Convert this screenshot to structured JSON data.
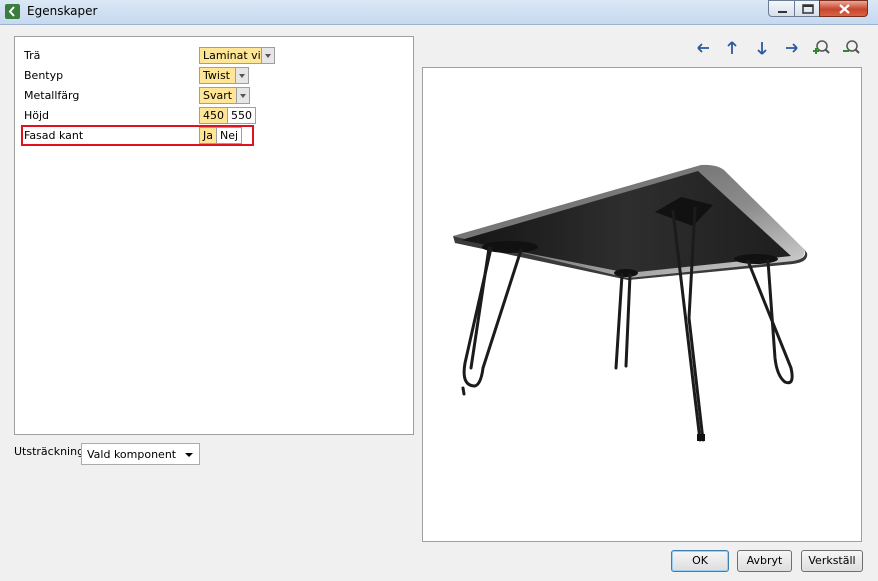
{
  "window": {
    "title": "Egenskaper"
  },
  "properties": [
    {
      "label": "Trä",
      "type": "combo",
      "value": "Laminat vit"
    },
    {
      "label": "Bentyp",
      "type": "combo",
      "value": "Twist"
    },
    {
      "label": "Metallfärg",
      "type": "combo",
      "value": "Svart"
    },
    {
      "label": "Höjd",
      "type": "segmented",
      "options": [
        "450",
        "550"
      ],
      "selected": "450"
    },
    {
      "label": "Fasad kant",
      "type": "segmented",
      "options": [
        "Ja",
        "Nej"
      ],
      "selected": "Ja"
    }
  ],
  "extent": {
    "label": "Utsträckning",
    "value": "Vald komponent"
  },
  "toolbar": {
    "icons": [
      "arrow-left-icon",
      "arrow-up-icon",
      "arrow-down-icon",
      "arrow-right-icon",
      "zoom-in-icon",
      "zoom-out-icon"
    ]
  },
  "buttons": {
    "ok": "OK",
    "cancel": "Avbryt",
    "apply": "Verkställ"
  },
  "colors": {
    "selected_value_bg": "#ffe697",
    "highlight_border": "#e0121f",
    "nav_icon": "#2a5a9e",
    "zoom_plus": "#2c8a2c"
  }
}
